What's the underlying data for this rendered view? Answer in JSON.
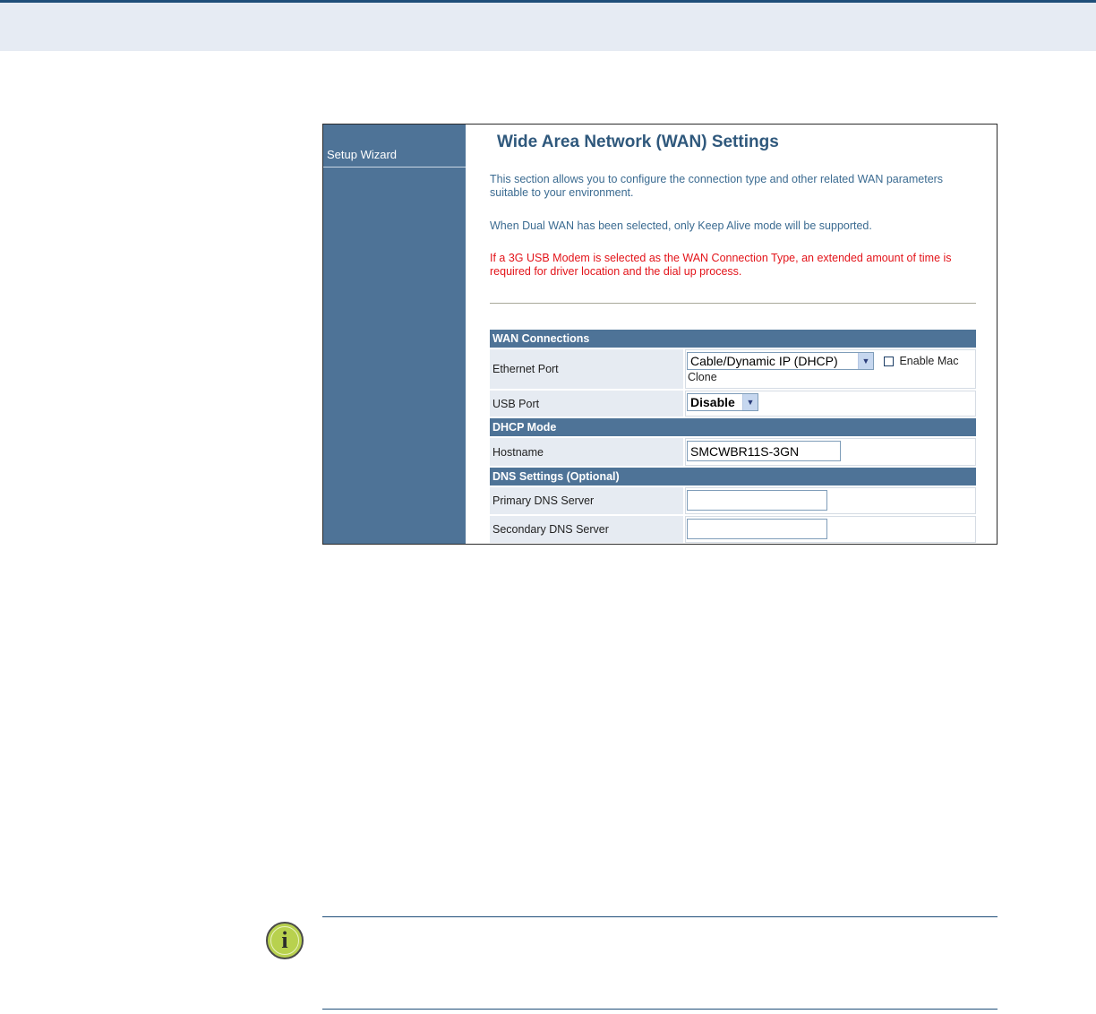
{
  "sidebar": {
    "items": [
      {
        "label": "Setup Wizard"
      }
    ]
  },
  "main": {
    "title": "Wide Area Network (WAN) Settings",
    "descriptions": [
      "This section allows you to configure the connection type and other related WAN parameters suitable to your environment.",
      "When Dual WAN has been selected, only Keep Alive mode will be supported."
    ],
    "warning": "If a 3G USB Modem is selected as the WAN Connection Type, an extended amount of time is required for driver location and the dial up process."
  },
  "form": {
    "wan_connections": {
      "header": "WAN Connections",
      "ethernet_label": "Ethernet Port",
      "ethernet_value": "Cable/Dynamic IP (DHCP)",
      "enable_mac_clone_label_1": "Enable Mac",
      "enable_mac_clone_label_2": "Clone",
      "enable_mac_clone_checked": false,
      "usb_label": "USB Port",
      "usb_value": "Disable"
    },
    "dhcp_mode": {
      "header": "DHCP Mode",
      "hostname_label": "Hostname",
      "hostname_value": "SMCWBR11S-3GN"
    },
    "dns_settings": {
      "header": "DNS Settings (Optional)",
      "primary_label": "Primary DNS Server",
      "primary_value": "",
      "secondary_label": "Secondary DNS Server",
      "secondary_value": ""
    }
  },
  "note": {
    "icon": "info-icon",
    "icon_glyph": "i"
  },
  "colors": {
    "header_band": "#e6ebf3",
    "sidebar": "#4e7397",
    "title": "#2f587c",
    "warning": "#e3141a",
    "note_icon": "#b8d14e"
  }
}
